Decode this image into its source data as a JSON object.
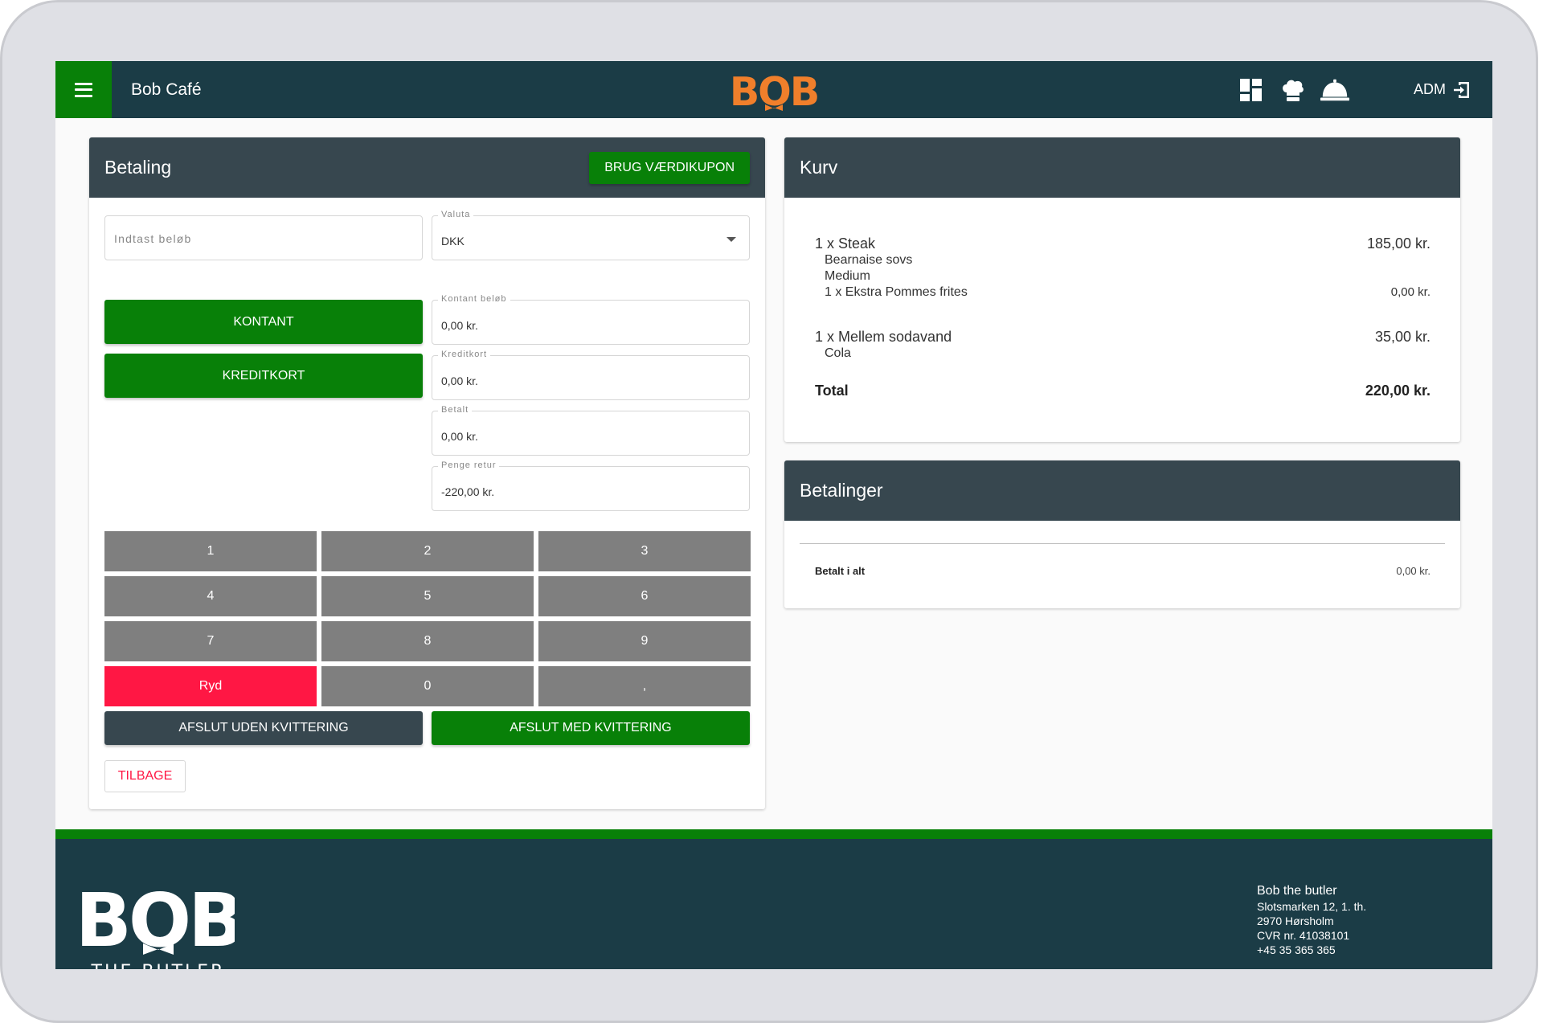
{
  "topbar": {
    "title": "Bob Café",
    "logo_text": "BOB",
    "user_label": "ADM",
    "icons": [
      "dashboard-icon",
      "chef-hat-icon",
      "service-bell-icon",
      "logout-icon"
    ]
  },
  "payment": {
    "title": "Betaling",
    "coupon_label": "BRUG VÆRDIKUPON",
    "amount_placeholder": "Indtast beløb",
    "currency_label": "Valuta",
    "currency_value": "DKK",
    "cash_button": "KONTANT",
    "card_button": "KREDITKORT",
    "cash_amount_label": "Kontant beløb",
    "cash_amount_value": "0,00 kr.",
    "credit_label": "Kreditkort",
    "credit_value": "0,00 kr.",
    "paid_label": "Betalt",
    "paid_value": "0,00 kr.",
    "change_label": "Penge retur",
    "change_value": "-220,00 kr.",
    "keypad": [
      "1",
      "2",
      "3",
      "4",
      "5",
      "6",
      "7",
      "8",
      "9",
      "Ryd",
      "0",
      ","
    ],
    "finish_without_receipt": "AFSLUT UDEN KVITTERING",
    "finish_with_receipt": "AFSLUT MED KVITTERING",
    "back_label": "TILBAGE"
  },
  "cart": {
    "title": "Kurv",
    "items": [
      {
        "name": "1 x Steak",
        "price": "185,00 kr.",
        "mods": [
          "Bearnaise sovs",
          "Medium"
        ],
        "extra": {
          "name": "1 x Ekstra Pommes frites",
          "price": "0,00 kr."
        }
      },
      {
        "name": "1 x Mellem sodavand",
        "price": "35,00 kr.",
        "mods": [
          "Cola"
        ]
      }
    ],
    "total_label": "Total",
    "total_value": "220,00 kr."
  },
  "payments": {
    "title": "Betalinger",
    "total_label": "Betalt i alt",
    "total_value": "0,00 kr."
  },
  "footer": {
    "logo_text": "BOB",
    "logo_sub": "THE BUTLER",
    "company": "Bob the butler",
    "address1": "Slotsmarken 12, 1. th.",
    "address2": "2970 Hørsholm",
    "cvr": "CVR nr. 41038101",
    "phone": "+45 35 365 365"
  },
  "colors": {
    "brand_green": "#088008",
    "brand_orange": "#f07f2b",
    "topbar_bg": "#1b3c46",
    "card_header": "#37474f",
    "key_grey": "#7f7f7f",
    "clear_red": "#ff1744"
  }
}
